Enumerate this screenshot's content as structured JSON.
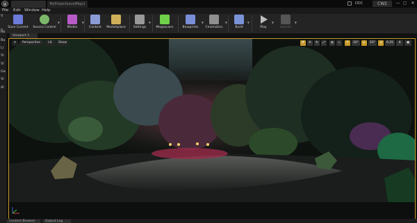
{
  "window": {
    "level_tab": "MyProjectLevelMap1",
    "source_control": "DDC",
    "project": "CW2",
    "min": "—",
    "max": "▢",
    "close": "✕"
  },
  "menu": [
    "File",
    "Edit",
    "Window",
    "Help"
  ],
  "toolbar": [
    {
      "label": "Save Current",
      "icon": "save-icon",
      "color": "#6c7bd8"
    },
    {
      "label": "Source Control",
      "icon": "source-control-icon",
      "color": "#7db86a"
    },
    {
      "label": "Modes",
      "icon": "modes-icon",
      "color": "#b85bc9"
    },
    {
      "label": "Content",
      "icon": "content-icon",
      "color": "#8a9bd6"
    },
    {
      "label": "Marketplace",
      "icon": "marketplace-icon",
      "color": "#d0b15a"
    },
    {
      "label": "Settings",
      "icon": "settings-icon",
      "color": "#999999"
    },
    {
      "label": "Megascans",
      "icon": "megascans-icon",
      "color": "#6fd14a"
    },
    {
      "label": "Blueprints",
      "icon": "blueprints-icon",
      "color": "#7a8ed8"
    },
    {
      "label": "Cinematics",
      "icon": "cinematics-icon",
      "color": "#8f8f8f"
    },
    {
      "label": "Build",
      "icon": "build-icon",
      "color": "#7a93d8"
    },
    {
      "label": "Play",
      "icon": "play-icon",
      "color": "#bdbdbd"
    },
    {
      "label": "Launch",
      "icon": "launch-icon",
      "color": "#555555"
    }
  ],
  "left_panel": [
    "V",
    "P",
    "Re",
    "Ba",
    "Li",
    "Vi",
    "Vi",
    "Ge",
    "Vi",
    "Al"
  ],
  "viewport": {
    "tab": "Viewport 1",
    "perspective": "Perspective",
    "lit": "Lit",
    "show": "Show",
    "grid_value": "10°",
    "rotation_value": "10°",
    "scale_value": "0.25",
    "camera_speed": "4"
  },
  "bottom_tabs": [
    "Content Browser",
    "Output Log"
  ],
  "colors": {
    "accent": "#c79a2a",
    "background": "#151515"
  }
}
